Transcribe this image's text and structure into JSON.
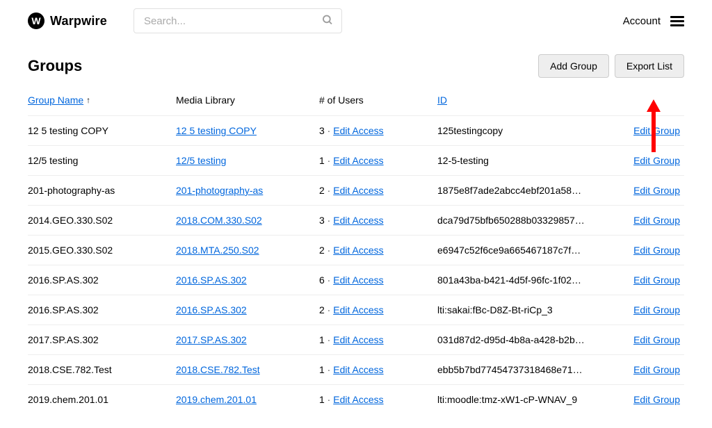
{
  "brand": {
    "logo_letter": "W",
    "name": "Warpwire"
  },
  "search": {
    "placeholder": "Search..."
  },
  "account": {
    "label": "Account"
  },
  "page": {
    "heading": "Groups"
  },
  "buttons": {
    "add_group": "Add Group",
    "export_list": "Export List"
  },
  "columns": {
    "group_name": "Group Name",
    "media_library": "Media Library",
    "users": "# of Users",
    "id": "ID"
  },
  "labels": {
    "edit_access": "Edit Access",
    "edit_group": "Edit Group",
    "sep": " · "
  },
  "sort": {
    "column": "group_name",
    "direction": "asc",
    "indicator": "↑"
  },
  "rows": [
    {
      "name": "12 5 testing COPY",
      "media": "12 5 testing COPY",
      "users": 3,
      "id": "125testingcopy"
    },
    {
      "name": "12/5 testing",
      "media": "12/5 testing",
      "users": 1,
      "id": "12-5-testing"
    },
    {
      "name": "201-photography-as",
      "media": "201-photography-as",
      "users": 2,
      "id": "1875e8f7ade2abcc4ebf201a58…"
    },
    {
      "name": "2014.GEO.330.S02",
      "media": "2018.COM.330.S02",
      "users": 3,
      "id": "dca79d75bfb650288b03329857…"
    },
    {
      "name": "2015.GEO.330.S02",
      "media": "2018.MTA.250.S02",
      "users": 2,
      "id": "e6947c52f6ce9a665467187c7f…"
    },
    {
      "name": "2016.SP.AS.302",
      "media": "2016.SP.AS.302",
      "users": 6,
      "id": "801a43ba-b421-4d5f-96fc-1f02…"
    },
    {
      "name": "2016.SP.AS.302",
      "media": "2016.SP.AS.302",
      "users": 2,
      "id": "lti:sakai:fBc-D8Z-Bt-riCp_3"
    },
    {
      "name": "2017.SP.AS.302",
      "media": "2017.SP.AS.302",
      "users": 1,
      "id": "031d87d2-d95d-4b8a-a428-b2b…"
    },
    {
      "name": "2018.CSE.782.Test",
      "media": "2018.CSE.782.Test",
      "users": 1,
      "id": "ebb5b7bd77454737318468e71…"
    },
    {
      "name": "2019.chem.201.01",
      "media": "2019.chem.201.01",
      "users": 1,
      "id": "lti:moodle:tmz-xW1-cP-WNAV_9"
    }
  ]
}
